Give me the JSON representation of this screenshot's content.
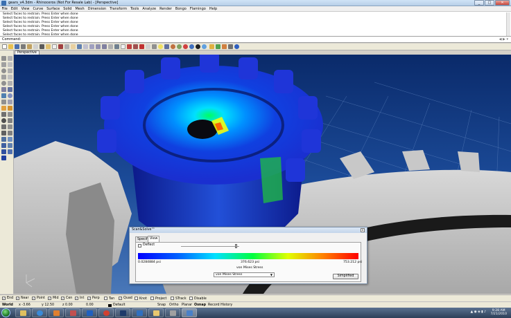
{
  "window": {
    "title": "gears_v4.3dm - Rhinoceros (Not For Resale Lab) - [Perspective]",
    "minimize": "_",
    "maximize": "□",
    "close": "✕"
  },
  "menu": [
    "File",
    "Edit",
    "View",
    "Curve",
    "Surface",
    "Solid",
    "Mesh",
    "Dimension",
    "Transform",
    "Tools",
    "Analyze",
    "Render",
    "Bongo",
    "Flamingo",
    "Help"
  ],
  "history": [
    "Select faces to restrain. Press Enter when done",
    "Select faces to restrain. Press Enter when done",
    "Select faces to restrain. Press Enter when done",
    "Select faces to restrain. Press Enter when done",
    "Select faces to restrain. Press Enter when done",
    "Select faces to restrain. Press Enter when done"
  ],
  "command": {
    "prompt": "Command:"
  },
  "viewport": {
    "name": "Perspective"
  },
  "dialog": {
    "title": "Scan&Solve™",
    "close": "x",
    "tabs": [
      "Specify",
      "View"
    ],
    "active_tab": 1,
    "deflect_label": "Deflect",
    "min_label": "0.0284884 psi",
    "mid_label": "376.623 psi",
    "max_label": "753.212 psi",
    "quantity_label": "von Mises Stress",
    "select_value": "von Mises Stress",
    "simplified_button": "Simplified",
    "colors": {
      "low": "#0000ff",
      "mid": "#00ff40",
      "high": "#ff0000"
    }
  },
  "osnaps": [
    {
      "label": "End",
      "checked": true
    },
    {
      "label": "Near",
      "checked": true
    },
    {
      "label": "Point",
      "checked": true
    },
    {
      "label": "Mid",
      "checked": true
    },
    {
      "label": "Cen",
      "checked": true
    },
    {
      "label": "Int",
      "checked": true
    },
    {
      "label": "Perp",
      "checked": true
    },
    {
      "label": "Tan",
      "checked": false
    },
    {
      "label": "Quad",
      "checked": true
    },
    {
      "label": "Knot",
      "checked": false
    },
    {
      "label": "Project",
      "checked": false
    },
    {
      "label": "STrack",
      "checked": false
    },
    {
      "label": "Disable",
      "checked": false
    }
  ],
  "status": {
    "cplane": "World",
    "x": "x -3.66",
    "y": "y 12.50",
    "z": "z 0.00",
    "units": "0.00",
    "layer": "Default",
    "snap": "Snap",
    "ortho": "Ortho",
    "planar": "Planar",
    "osnap": "Osnap",
    "record": "Record History"
  },
  "taskbar": {
    "time": "9:28 AM",
    "date": "7/21/2010",
    "apps": [
      "explorer",
      "ie",
      "media",
      "firefox",
      "paint",
      "chrome",
      "ps",
      "outlook",
      "folder",
      "rhino-active"
    ]
  }
}
